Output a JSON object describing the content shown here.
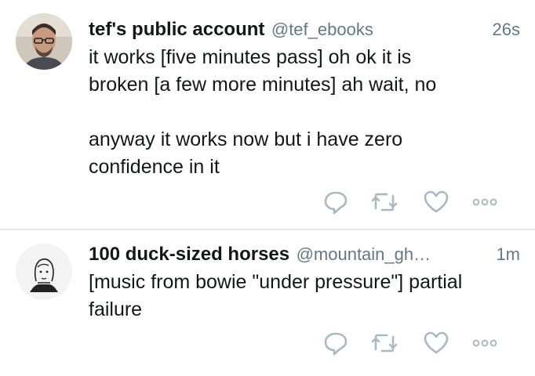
{
  "tweets": [
    {
      "name": "tef's public account",
      "handle": "@tef_ebooks",
      "time": "26s",
      "text": "it works [five minutes pass] oh ok it is\nbroken [a few more minutes] ah wait, no\n\nanyway it works now but i have zero\nconfidence in it",
      "avatar_icon": "photo-avatar"
    },
    {
      "name": "100 duck-sized horses",
      "handle": "@mountain_gh…",
      "time": "1m",
      "text": "[music from bowie \"under pressure\"] partial\nfailure",
      "avatar_icon": "sketch-avatar"
    }
  ],
  "actions": [
    "reply-icon",
    "retweet-icon",
    "like-icon",
    "more-icon"
  ],
  "colors": {
    "text": "#14171a",
    "secondary": "#657786",
    "icon": "#aab8c2",
    "divider": "#e1e8ed"
  }
}
